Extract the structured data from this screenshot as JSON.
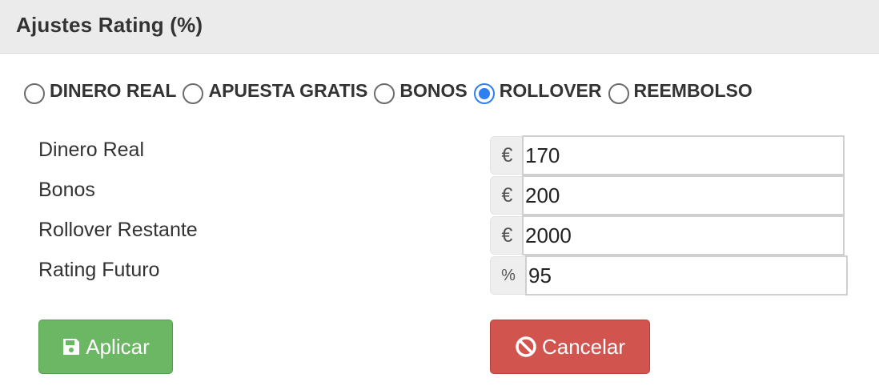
{
  "header": {
    "title": "Ajustes Rating (%)"
  },
  "radio_options": [
    {
      "label": "DINERO REAL",
      "checked": false
    },
    {
      "label": "APUESTA GRATIS",
      "checked": false
    },
    {
      "label": "BONOS",
      "checked": false
    },
    {
      "label": "ROLLOVER",
      "checked": true
    },
    {
      "label": "REEMBOLSO",
      "checked": false
    }
  ],
  "fields": [
    {
      "label": "Dinero Real",
      "addon": "€",
      "value": "170"
    },
    {
      "label": "Bonos",
      "addon": "€",
      "value": "200"
    },
    {
      "label": "Rollover Restante",
      "addon": "€",
      "value": "2000"
    },
    {
      "label": "Rating Futuro",
      "addon": "%",
      "value": "95"
    }
  ],
  "buttons": {
    "apply_label": "Aplicar",
    "apply_icon": "save-icon",
    "cancel_label": "Cancelar",
    "cancel_icon": "ban-icon"
  },
  "colors": {
    "accent": "#2f7ff0",
    "apply": "#6cb764",
    "cancel": "#d1544f"
  }
}
